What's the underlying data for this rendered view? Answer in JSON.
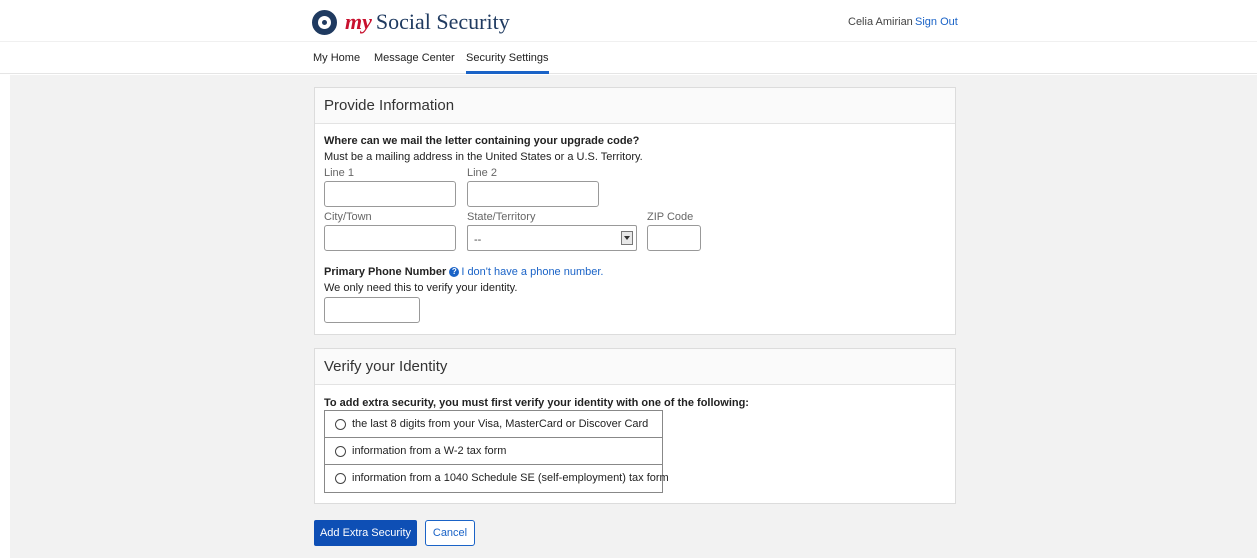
{
  "header": {
    "brand_prefix": "my",
    "brand_name": "Social Security",
    "user_name": "Celia Amirian",
    "sign_out": "Sign Out"
  },
  "nav": {
    "items": [
      {
        "label": "My Home"
      },
      {
        "label": "Message Center"
      },
      {
        "label": "Security Settings",
        "active": true
      }
    ]
  },
  "provide_information": {
    "title": "Provide Information",
    "question": "Where can we mail the letter containing your upgrade code?",
    "note": "Must be a mailing address in the United States or a U.S. Territory.",
    "line1_label": "Line 1",
    "line1_value": "",
    "line2_label": "Line 2",
    "line2_value": "",
    "city_label": "City/Town",
    "city_value": "",
    "state_label": "State/Territory",
    "state_selected": "--",
    "zip_label": "ZIP Code",
    "zip_value": "",
    "phone_label": "Primary Phone Number",
    "no_phone_link": "I don't have a phone number.",
    "phone_note": "We only need this to verify your identity.",
    "phone_value": ""
  },
  "verify_identity": {
    "title": "Verify your Identity",
    "instruction": "To add extra security, you must first verify your identity with one of the following:",
    "options": [
      {
        "label": "the last 8 digits from your Visa, MasterCard or Discover Card"
      },
      {
        "label": "information from a W-2 tax form"
      },
      {
        "label": "information from a 1040 Schedule SE (self-employment) tax form"
      }
    ]
  },
  "actions": {
    "primary": "Add Extra Security",
    "cancel": "Cancel"
  },
  "colors": {
    "accent": "#1a63c7",
    "brand_red": "#c8102e",
    "brand_navy": "#1f3a60",
    "primary_button": "#0e4fb5",
    "page_background": "#f2f2f2"
  },
  "icons": {
    "logo": "ssa-seal-icon",
    "help": "question-circle-icon",
    "select": "chevron-down-icon",
    "radio": "radio-empty-icon"
  }
}
